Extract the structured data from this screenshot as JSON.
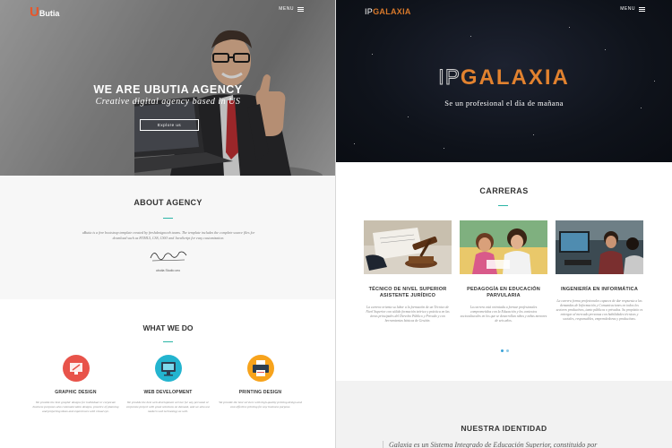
{
  "left_site": {
    "logo": {
      "letter": "U",
      "name": "Butia"
    },
    "menu_label": "MENU",
    "hero": {
      "title": "WE ARE UBUTIA AGENCY",
      "subtitle": "Creative digital agency based in US",
      "button": "Explore us"
    },
    "about": {
      "title": "ABOUT AGENCY",
      "text": "uButia is a free bootstrap template created by freshdesignweb teams. The template includes the complete source files for download such as HTML5, CSS, CSS3 and JavaScript for easy customization.",
      "signature_caption": "ubutia Studio ceo"
    },
    "what_we_do": {
      "title": "WHAT WE DO",
      "services": [
        {
          "title": "GRAPHIC DESIGN",
          "text": "We provide the best graphic designs for individual or corporate business purposes also communication designs, practice of planning and projecting ideas and experiences with visual eye.",
          "icon": "graphic-design-icon",
          "color": "#e8534a"
        },
        {
          "title": "WEB DEVELOPMENT",
          "text": "We provide the best web development service for any personal or corporate project with great solutions on demand, and we also use modern web technology as well.",
          "icon": "web-development-icon",
          "color": "#23b4cf"
        },
        {
          "title": "PRINTING DESIGN",
          "text": "We provide the best services with high-quality printing design and cost-effective printing for any business purpose.",
          "icon": "printing-design-icon",
          "color": "#f7a31c"
        }
      ]
    }
  },
  "right_site": {
    "logo": {
      "prefix": "IP",
      "name": "GALAXIA"
    },
    "menu_label": "MENU",
    "hero": {
      "logo_prefix": "IP",
      "logo_name": "GALAXIA",
      "subtitle": "Se un profesional el día de mañana"
    },
    "carreras": {
      "title": "CARRERAS",
      "cards": [
        {
          "title": "TÉCNICO DE NIVEL SUPERIOR ASISTENTE JURÍDICO",
          "text": "La carrera orienta su labor a la formación de un Técnico de Nivel Superior con sólida formación teórica y práctica en las áreas principales del Derecho Público y Privado y con herramientas básicas de Gestión."
        },
        {
          "title": "PEDAGOGÍA EN EDUCACIÓN PARVULARIA",
          "text": "La carrera está orientada a formar profesionales comprometidos con la Educación y los contextos socioculturales en los que se desarrollan niños y niñas menores de seis años."
        },
        {
          "title": "INGENIERÍA EN INFORMÁTICA",
          "text": "La carrera forma profesionales capaces de dar respuesta a las demandas de Información y Comunicaciones en todos los sectores productivos, tanto públicos o privados. Su propósito es entregar al mercado personas con habilidades técnicas y sociales, responsables, emprendedoras y productivas."
        }
      ]
    },
    "identidad": {
      "title": "NUESTRA IDENTIDAD",
      "text": "Galaxia es un Sistema Integrado de Educación Superior, constituido por"
    }
  },
  "colors": {
    "accent_teal": "#2bb5a6",
    "ubutia_orange": "#e8562a",
    "galaxia_orange": "#e2822f",
    "dot_blue": "#3aa3d8"
  }
}
